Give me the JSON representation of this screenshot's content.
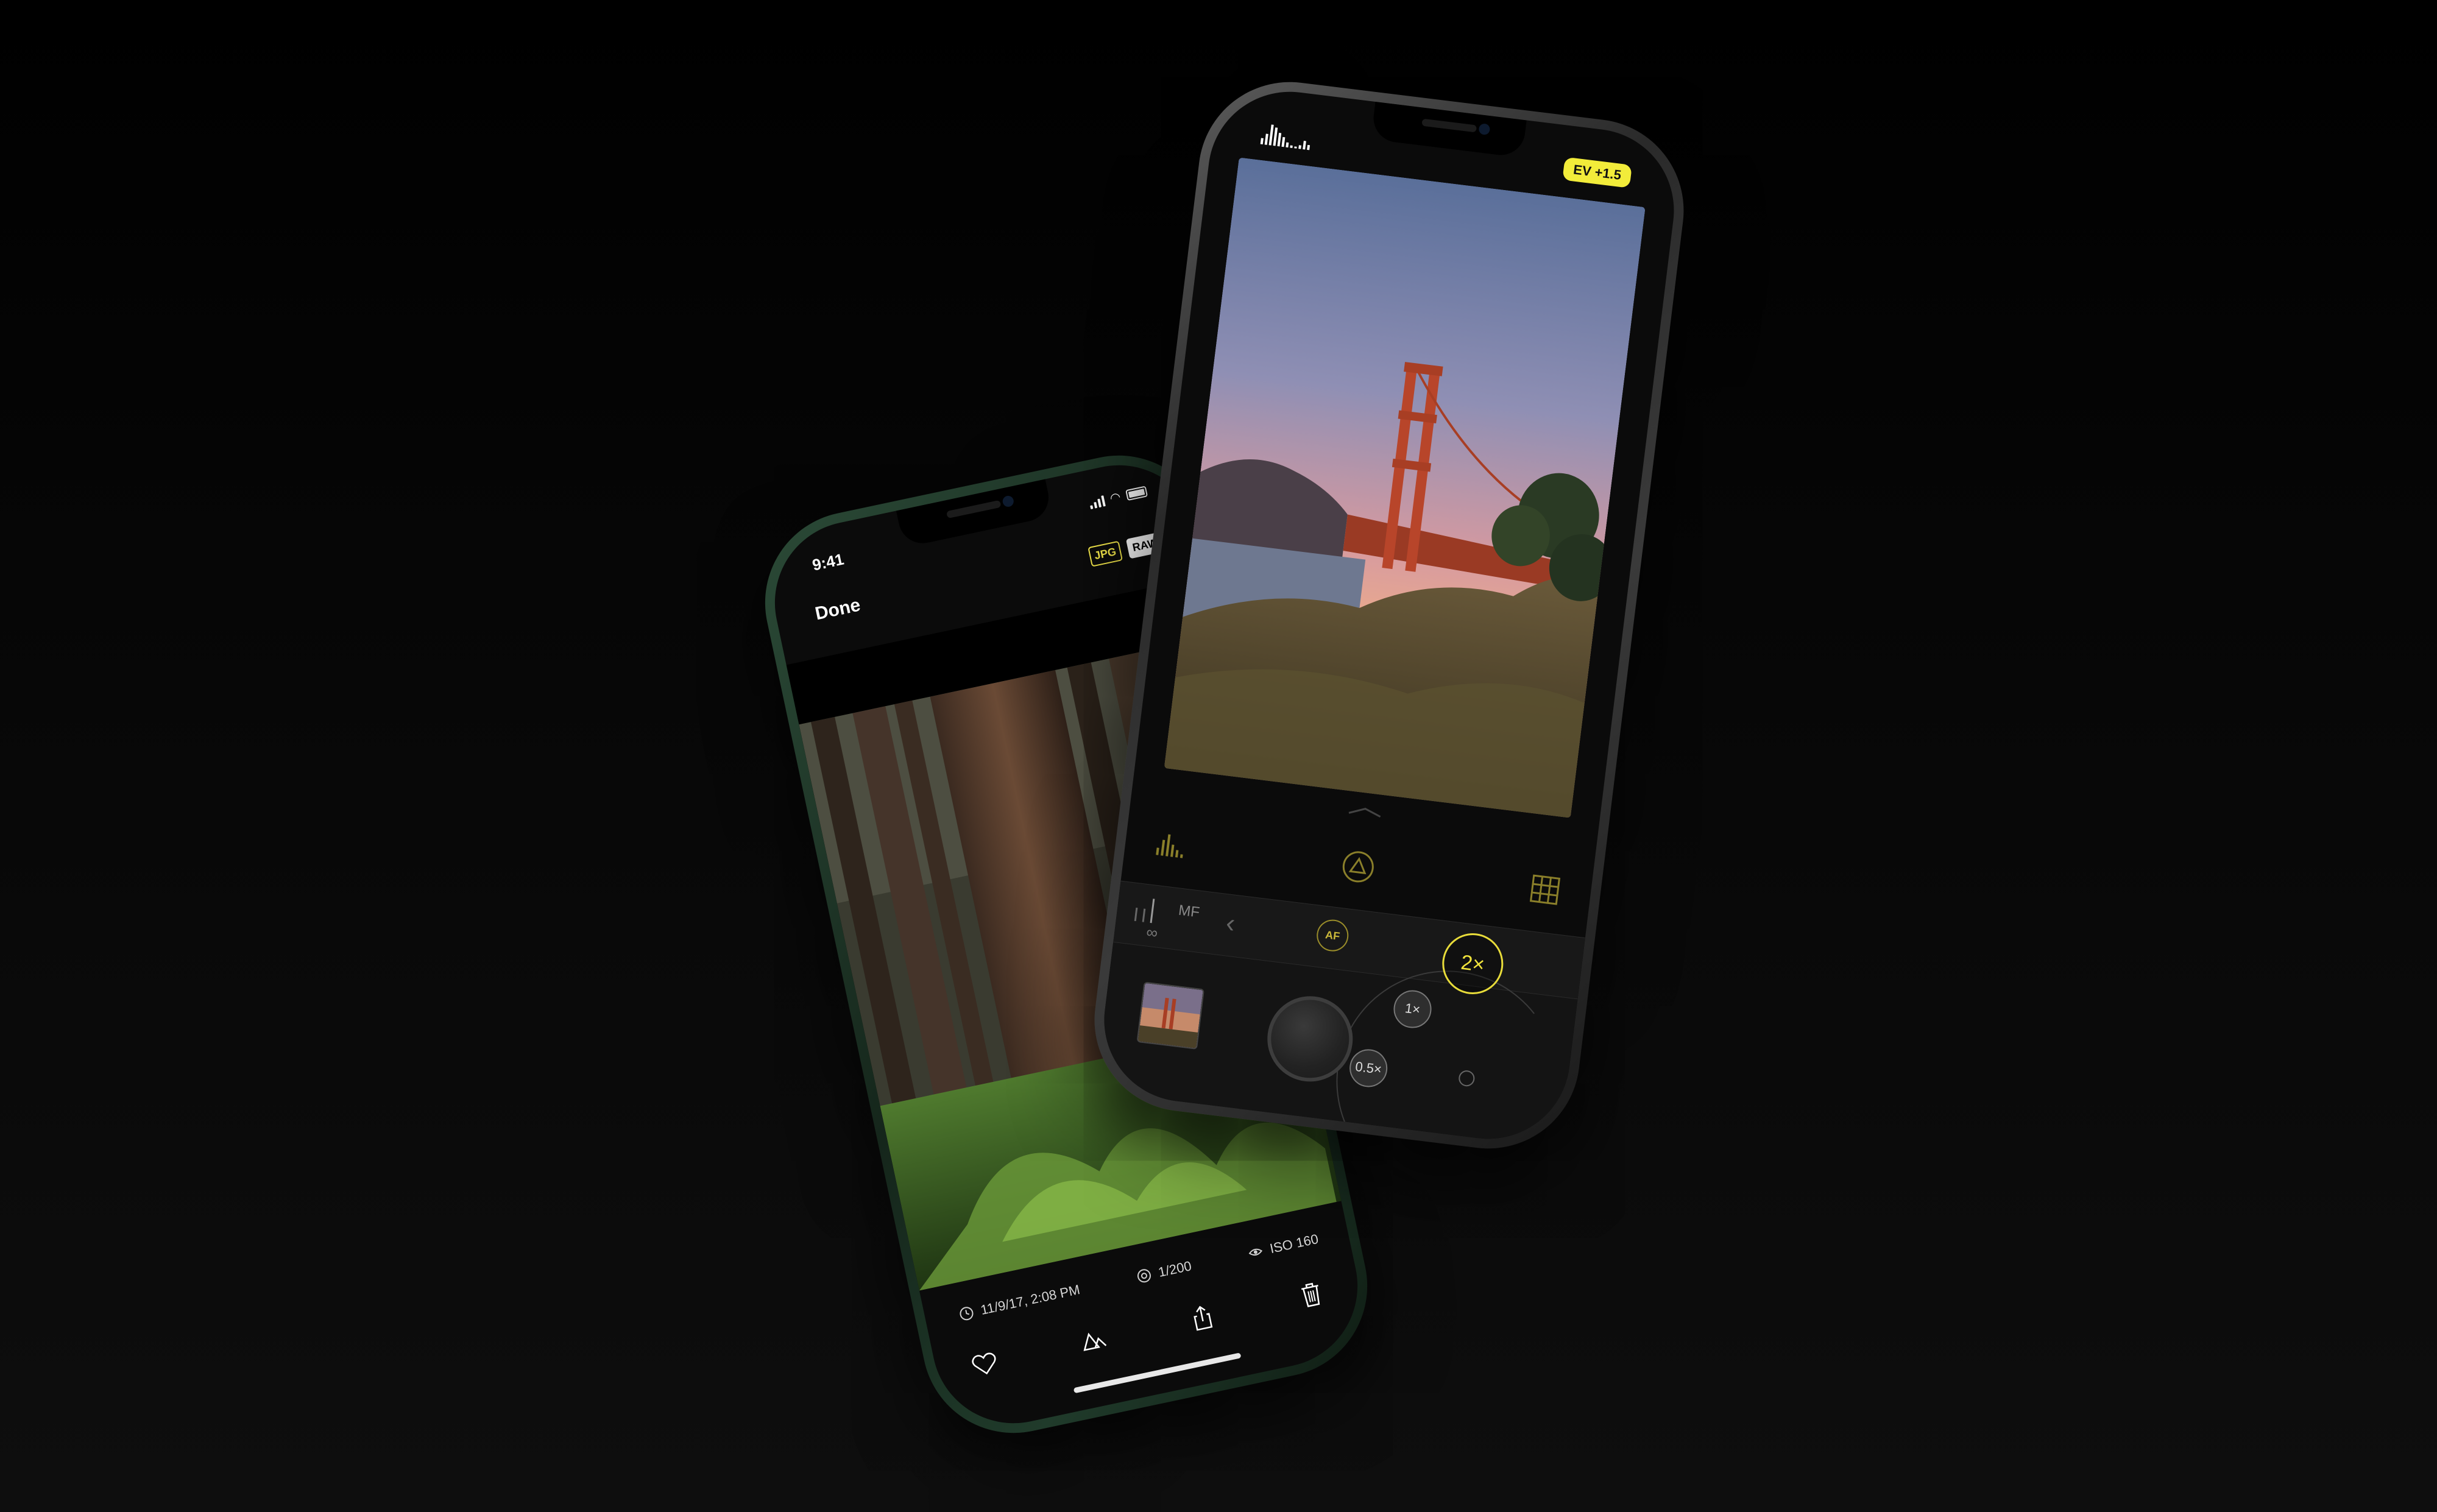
{
  "gallery_phone": {
    "status": {
      "time": "9:41"
    },
    "top_bar": {
      "done_label": "Done",
      "badge_jpg": "JPG",
      "badge_raw": "RAW"
    },
    "photo": {
      "subject": "redwood forest"
    },
    "metadata": {
      "date": "11/9/17, 2:08 PM",
      "shutter": "1/200",
      "iso": "ISO 160"
    },
    "toolbar": [
      "heart-icon",
      "adjust-icon",
      "share-icon",
      "trash-icon"
    ]
  },
  "camera_phone": {
    "ev_label": "EV +1.5",
    "photo": {
      "subject": "Golden Gate Bridge at sunset"
    },
    "controls": [
      "histogram-icon",
      "exposure-triangle-icon",
      "grid-icon"
    ],
    "focus": {
      "mode_label": "MF",
      "infinity_symbol": "∞",
      "af_label": "AF"
    },
    "lenses": {
      "tele": "2×",
      "wide": "1×",
      "ultra_wide": "0.5×"
    }
  },
  "colors": {
    "accent_yellow": "#f2ec3a",
    "background": "#0a0a0a",
    "gallery_frame": "#1e3526",
    "camera_frame": "#333333"
  }
}
